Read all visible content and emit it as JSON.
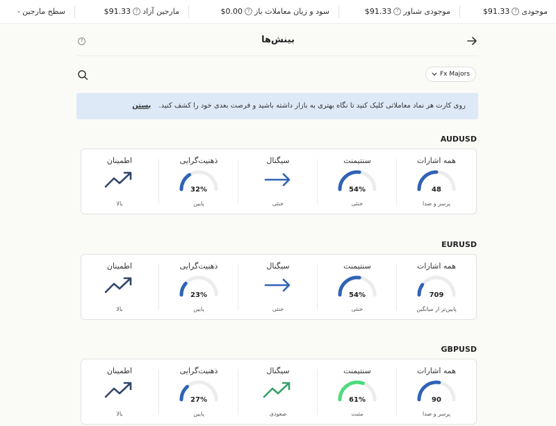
{
  "topbar": {
    "balance_label": "موجودی",
    "balance_value": "$91.33",
    "equity_label": "موجودی شناور",
    "equity_value": "$91.33",
    "pnl_label": "سود و زیان معاملات باز",
    "pnl_value": "$0.00",
    "free_margin_label": "مارجین آزاد",
    "free_margin_value": "$91.33",
    "margin_level_label": "سطح مارجین",
    "margin_level_value": "-"
  },
  "header": {
    "title": "بینش‌ها"
  },
  "filter": {
    "label": "Fx Majors"
  },
  "banner": {
    "text": "روی کارت هر نماد معاملاتی کلیک کنید تا نگاه بهتری به بازار داشته باشید و فرصت بعدی خود را کشف کنید.",
    "close_label": "بستن"
  },
  "labels": {
    "all_signals": "همه اشارات",
    "sentiment": "سنتیمنت",
    "signal": "سیگنال",
    "mindset": "ذهنیت‌گرایی",
    "confidence": "اطمینان"
  },
  "colors": {
    "blue": "#2f63b5",
    "green": "#4cdb7d",
    "track": "#ececec",
    "arrow_green": "#36a06a",
    "arrow_dark": "#33456b"
  },
  "cards": [
    {
      "symbol": "AUDUSD",
      "all_signals": {
        "value": "48",
        "sub": "پرسر و صدا",
        "fill": 0.5
      },
      "sentiment": {
        "value": "54%",
        "sub": "خنثی",
        "fill": 0.54,
        "color": "blue"
      },
      "signal": {
        "sub": "خنثی",
        "icon": "arrow-right-icon"
      },
      "mindset": {
        "value": "32%",
        "sub": "پایین",
        "fill": 0.32
      },
      "confidence": {
        "sub": "بالا",
        "icon": "trend-up-icon"
      }
    },
    {
      "symbol": "EURUSD",
      "all_signals": {
        "value": "709",
        "sub": "پایین‌تر از میانگین",
        "fill": 0.2
      },
      "sentiment": {
        "value": "54%",
        "sub": "خنثی",
        "fill": 0.54,
        "color": "blue"
      },
      "signal": {
        "sub": "خنثی",
        "icon": "arrow-right-icon"
      },
      "mindset": {
        "value": "23%",
        "sub": "پایین",
        "fill": 0.23
      },
      "confidence": {
        "sub": "بالا",
        "icon": "trend-up-icon"
      }
    },
    {
      "symbol": "GBPUSD",
      "all_signals": {
        "value": "90",
        "sub": "پرسر و صدا",
        "fill": 0.55
      },
      "sentiment": {
        "value": "61%",
        "sub": "مثبت",
        "fill": 0.61,
        "color": "green"
      },
      "signal": {
        "sub": "صعودی",
        "icon": "trend-up-icon",
        "color": "green"
      },
      "mindset": {
        "value": "27%",
        "sub": "پایین",
        "fill": 0.27
      },
      "confidence": {
        "sub": "بالا",
        "icon": "trend-up-icon"
      }
    }
  ]
}
